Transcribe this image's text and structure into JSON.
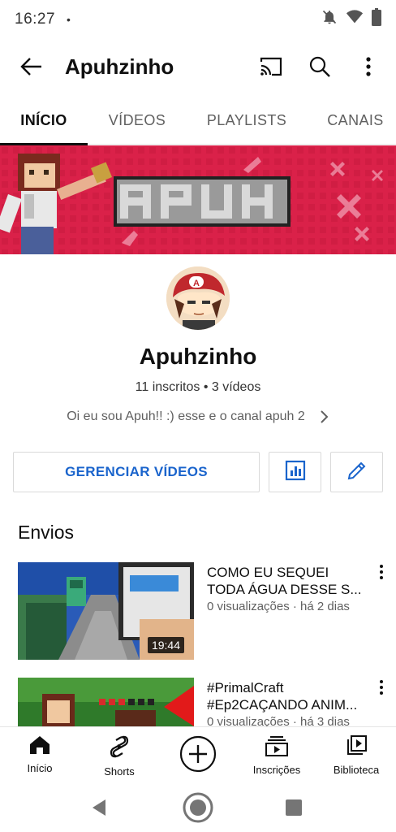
{
  "status": {
    "time": "16:27",
    "dot": "•",
    "icons": [
      "bell-off-icon",
      "wifi-icon",
      "battery-icon"
    ]
  },
  "app_bar": {
    "title": "Apuhzinho",
    "icons": [
      "back-arrow-icon",
      "cast-icon",
      "search-icon",
      "more-vert-icon"
    ]
  },
  "tabs": [
    {
      "label": "INÍCIO",
      "active": true
    },
    {
      "label": "VÍDEOS",
      "active": false
    },
    {
      "label": "PLAYLISTS",
      "active": false
    },
    {
      "label": "CANAIS",
      "active": false
    }
  ],
  "banner": {
    "text": "APUH",
    "bg_color": "#d81f45"
  },
  "channel": {
    "name": "Apuhzinho",
    "stats": "11 inscritos • 3 vídeos",
    "description": "Oi eu sou Apuh!! :) esse e o canal apuh 2"
  },
  "actions": {
    "manage_label": "GERENCIAR VÍDEOS",
    "analytics_icon": "analytics-icon",
    "edit_icon": "pencil-icon",
    "accent": "#1a64cc"
  },
  "section": {
    "title": "Envios"
  },
  "videos": [
    {
      "title_line1": "COMO EU SEQUEI",
      "title_line2": "TODA ÁGUA DESSE S...",
      "meta": "0 visualizações · há 2 dias",
      "duration": "19:44"
    },
    {
      "title_line1": "#PrimalCraft",
      "title_line2": "#Ep2CAÇANDO ANIM...",
      "meta": "0 visualizações · há 3 dias",
      "duration": ""
    }
  ],
  "bottom_nav": [
    {
      "label": "Início",
      "icon": "home-icon"
    },
    {
      "label": "Shorts",
      "icon": "shorts-icon"
    },
    {
      "label": "",
      "icon": "create-plus-icon"
    },
    {
      "label": "Inscrições",
      "icon": "subscriptions-icon"
    },
    {
      "label": "Biblioteca",
      "icon": "library-icon"
    }
  ],
  "system_nav": [
    "back-triangle-icon",
    "home-circle-icon",
    "recents-square-icon"
  ]
}
